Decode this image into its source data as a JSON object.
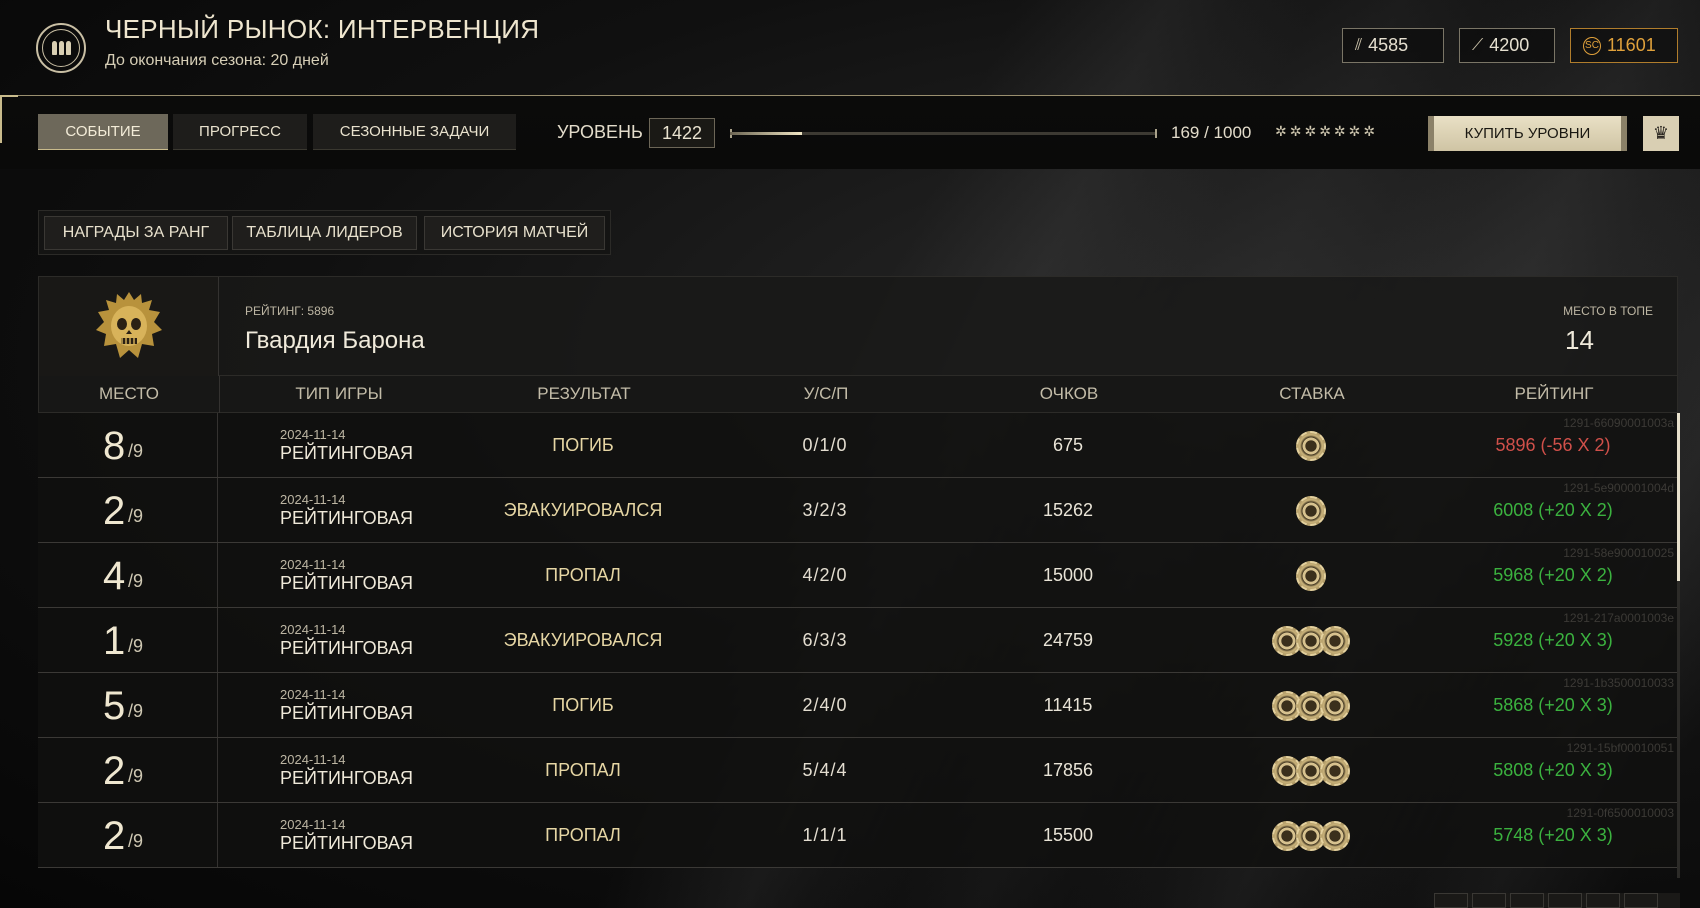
{
  "header": {
    "title": "ЧЕРНЫЙ РЫНОК: ИНТЕРВЕНЦИЯ",
    "subtitle": "До окончания сезона: 20 дней",
    "currencies": [
      {
        "icon": "bullet-pile-icon",
        "value": "4585"
      },
      {
        "icon": "ammo-shell-icon",
        "value": "4200"
      },
      {
        "icon": "gold-coin-icon",
        "value": "11601",
        "color": "#e0a13b"
      }
    ]
  },
  "topbar": {
    "tabs": [
      "СОБЫТИЕ",
      "ПРОГРЕСС",
      "СЕЗОННЫЕ ЗАДАЧИ"
    ],
    "active_tab": "СОБЫТИЕ",
    "level_label": "УРОВЕНЬ",
    "level_value": "1422",
    "progress_text": "169 / 1000",
    "progress_fraction": 0.169,
    "stars": "✲✲✲✲✲✲✲",
    "buy_button": "КУПИТЬ УРОВНИ"
  },
  "subtabs": [
    "НАГРАДЫ ЗА РАНГ",
    "ТАБЛИЦА ЛИДЕРОВ",
    "ИСТОРИЯ МАТЧЕЙ"
  ],
  "team": {
    "rating_label": "РЕЙТИНГ: 5896",
    "name": "Гвардия Барона",
    "top_label": "МЕСТО В ТОПЕ",
    "top_value": "14"
  },
  "columns": [
    "МЕСТО",
    "ТИП ИГРЫ",
    "РЕЗУЛЬТАТ",
    "У/С/П",
    "ОЧКОВ",
    "СТАВКА",
    "РЕЙТИНГ"
  ],
  "rows": [
    {
      "place": "8",
      "of": "/9",
      "date": "2024-11-14",
      "type": "РЕЙТИНГОВАЯ",
      "result": "ПОГИБ",
      "kda": "0/1/0",
      "score": "675",
      "chips": 1,
      "rating": "5896 (-56 X 2)",
      "trend": "neg",
      "match_id": "1291-66090001003a"
    },
    {
      "place": "2",
      "of": "/9",
      "date": "2024-11-14",
      "type": "РЕЙТИНГОВАЯ",
      "result": "ЭВАКУИРОВАЛСЯ",
      "kda": "3/2/3",
      "score": "15262",
      "chips": 1,
      "rating": "6008 (+20 X 2)",
      "trend": "pos",
      "match_id": "1291-5e900001004d"
    },
    {
      "place": "4",
      "of": "/9",
      "date": "2024-11-14",
      "type": "РЕЙТИНГОВАЯ",
      "result": "ПРОПАЛ",
      "kda": "4/2/0",
      "score": "15000",
      "chips": 1,
      "rating": "5968 (+20 X 2)",
      "trend": "pos",
      "match_id": "1291-58e900010025"
    },
    {
      "place": "1",
      "of": "/9",
      "date": "2024-11-14",
      "type": "РЕЙТИНГОВАЯ",
      "result": "ЭВАКУИРОВАЛСЯ",
      "kda": "6/3/3",
      "score": "24759",
      "chips": 3,
      "rating": "5928 (+20 X 3)",
      "trend": "pos",
      "match_id": "1291-217a0001003e"
    },
    {
      "place": "5",
      "of": "/9",
      "date": "2024-11-14",
      "type": "РЕЙТИНГОВАЯ",
      "result": "ПОГИБ",
      "kda": "2/4/0",
      "score": "11415",
      "chips": 3,
      "rating": "5868 (+20 X 3)",
      "trend": "pos",
      "match_id": "1291-1b3500010033"
    },
    {
      "place": "2",
      "of": "/9",
      "date": "2024-11-14",
      "type": "РЕЙТИНГОВАЯ",
      "result": "ПРОПАЛ",
      "kda": "5/4/4",
      "score": "17856",
      "chips": 3,
      "rating": "5808 (+20 X 3)",
      "trend": "pos",
      "match_id": "1291-15bf00010051"
    },
    {
      "place": "2",
      "of": "/9",
      "date": "2024-11-14",
      "type": "РЕЙТИНГОВАЯ",
      "result": "ПРОПАЛ",
      "kda": "1/1/1",
      "score": "15500",
      "chips": 3,
      "rating": "5748 (+20 X 3)",
      "trend": "pos",
      "match_id": "1291-0f6500010003"
    }
  ],
  "colors": {
    "positive": "#3bb23f",
    "negative": "#d0504a",
    "accent": "#e0a13b"
  }
}
